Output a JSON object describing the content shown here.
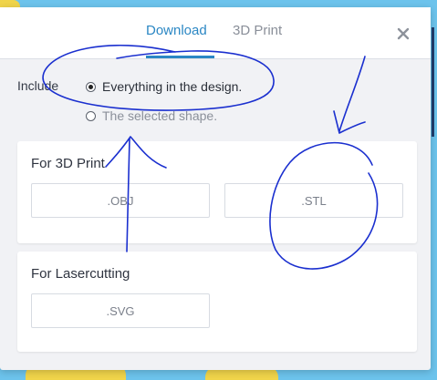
{
  "tabs": [
    {
      "label": "Download",
      "active": true
    },
    {
      "label": "3D Print",
      "active": false
    }
  ],
  "include": {
    "label": "Include",
    "options": [
      {
        "label": "Everything in the design.",
        "selected": true
      },
      {
        "label": "The selected shape.",
        "selected": false
      }
    ]
  },
  "sections": [
    {
      "title": "For 3D Print",
      "buttons": [
        ".OBJ",
        ".STL"
      ]
    },
    {
      "title": "For Lasercutting",
      "buttons": [
        ".SVG"
      ]
    }
  ],
  "colors": {
    "accent": "#2b87c4",
    "annotation_ink": "#1a2fcf",
    "background": "#6cc3ec"
  },
  "icons": {
    "close": "close-icon"
  }
}
